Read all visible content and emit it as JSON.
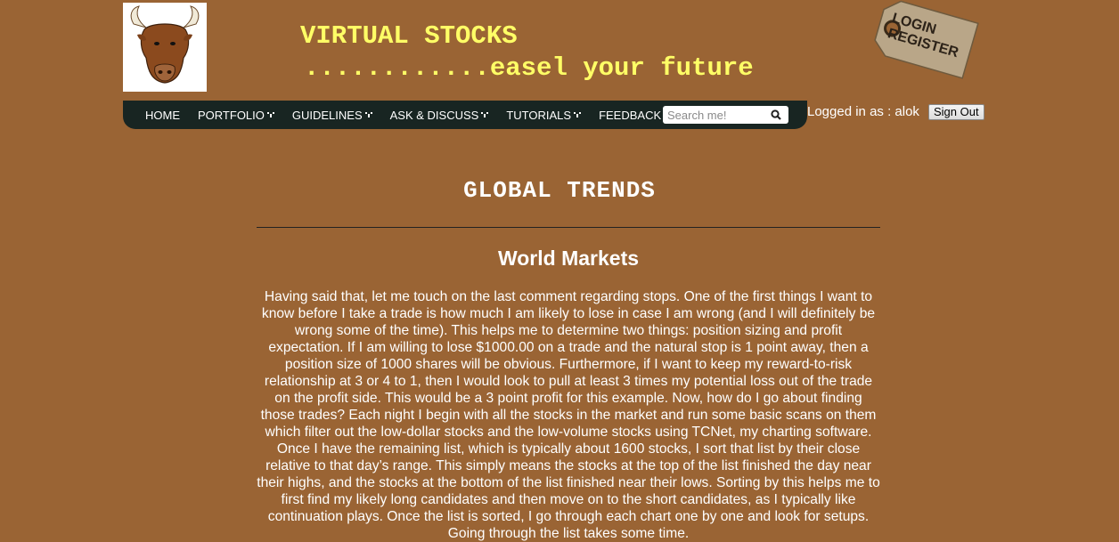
{
  "header": {
    "brand_title": "VIRTUAL STOCKS",
    "brand_tagline": "............easel your future",
    "logo": "bull-logo",
    "login_tag": {
      "line1": "LOGIN",
      "line2": "REGISTER"
    }
  },
  "nav": {
    "items": [
      {
        "label": "HOME",
        "has_dropdown": false
      },
      {
        "label": "PORTFOLIO",
        "has_dropdown": true
      },
      {
        "label": "GUIDELINES",
        "has_dropdown": true
      },
      {
        "label": "ASK & DISCUSS",
        "has_dropdown": true
      },
      {
        "label": "TUTORIALS",
        "has_dropdown": true
      },
      {
        "label": "FEEDBACK",
        "has_dropdown": false
      }
    ],
    "search_placeholder": "Search me!",
    "search_icon": "search-icon"
  },
  "user": {
    "status_text": "Logged in as : alok",
    "signout_label": "Sign Out"
  },
  "main": {
    "title": "GLOBAL TRENDS",
    "section_heading": "World Markets",
    "body": "Having said that, let me touch on the last comment regarding stops. One of the first things I want to know before I take a trade is how much I am likely to lose in case I am wrong (and I will definitely be wrong some of the time). This helps me to determine two things: position sizing and profit expectation. If I am willing to lose $1000.00 on a trade and the natural stop is 1 point away, then a position size of 1000 shares will be obvious. Furthermore, if I want to keep my reward-to-risk relationship at 3 or 4 to 1, then I would look to pull at least 3 times my potential loss out of the trade on the profit side. This would be a 3 point profit for this example. Now, how do I go about finding those trades? Each night I begin with all the stocks in the market and run some basic scans on them which filter out the low-dollar stocks and the low-volume stocks using TCNet, my charting software. Once I have the remaining list, which is typically about 1600 stocks, I sort that list by their close relative to that day’s range. This simply means the stocks at the top of the list finished the day near their highs, and the stocks at the bottom of the list finished near their lows. Sorting by this helps me to first find my likely long candidates and then move on to the short candidates, as I typically like continuation plays. Once the list is sorted, I go through each chart one by one and look for setups. Going through the list takes some time."
  },
  "colors": {
    "background": "#9a6434",
    "navbar": "#182522",
    "brand_text": "#ffff66",
    "text": "#ffffff"
  }
}
